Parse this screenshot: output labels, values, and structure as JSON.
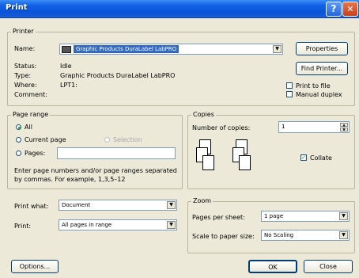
{
  "window": {
    "title": "Print"
  },
  "printer": {
    "group_label": "Printer",
    "name_label": "Name:",
    "name_value": "Graphic Products DuraLabel LabPRO",
    "status_label": "Status:",
    "status_value": "Idle",
    "type_label": "Type:",
    "type_value": "Graphic Products DuraLabel LabPRO",
    "where_label": "Where:",
    "where_value": "LPT1:",
    "comment_label": "Comment:",
    "comment_value": "",
    "properties_button": "Properties",
    "find_printer_button": "Find Printer...",
    "print_to_file_label": "Print to file",
    "manual_duplex_label": "Manual duplex"
  },
  "page_range": {
    "group_label": "Page range",
    "all_label": "All",
    "current_page_label": "Current page",
    "selection_label": "Selection",
    "pages_label": "Pages:",
    "pages_value": "",
    "hint": "Enter page numbers and/or page ranges separated by commas. For example, 1,3,5–12",
    "selected": "All"
  },
  "copies": {
    "group_label": "Copies",
    "number_label": "Number of copies:",
    "number_value": "1",
    "collate_label": "Collate",
    "collate_checked": true
  },
  "print_what": {
    "label": "Print what:",
    "value": "Document"
  },
  "print": {
    "label": "Print:",
    "value": "All pages in range"
  },
  "zoom": {
    "group_label": "Zoom",
    "pages_per_sheet_label": "Pages per sheet:",
    "pages_per_sheet_value": "1 page",
    "scale_label": "Scale to paper size:",
    "scale_value": "No Scaling"
  },
  "footer": {
    "options_button": "Options...",
    "ok_button": "OK",
    "close_button": "Close"
  }
}
